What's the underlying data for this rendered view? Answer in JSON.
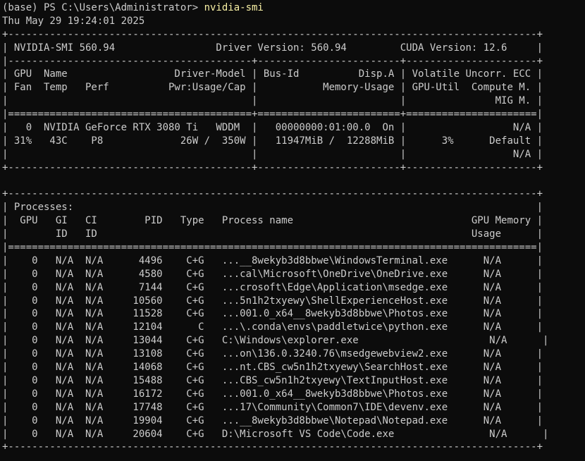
{
  "prompt": {
    "text": "(base) PS C:\\Users\\Administrator> ",
    "command": "nvidia-smi"
  },
  "timestamp": "Thu May 29 19:24:01 2025",
  "summary": {
    "border_top": "+-----------------------------------------------------------------------------------------+",
    "header": "| NVIDIA-SMI 560.94                 Driver Version: 560.94         CUDA Version: 12.6     |",
    "sep1": "|-----------------------------------------+------------------------+----------------------+",
    "col_header_1": "| GPU  Name                  Driver-Model | Bus-Id          Disp.A | Volatile Uncorr. ECC |",
    "col_header_2": "| Fan  Temp   Perf          Pwr:Usage/Cap |           Memory-Usage | GPU-Util  Compute M. |",
    "col_header_3": "|                                         |                        |               MIG M. |",
    "sep2": "|=========================================+========================+======================|",
    "gpu_row_1": "|   0  NVIDIA GeForce RTX 3080 Ti   WDDM  |   00000000:01:00.0  On |                  N/A |",
    "gpu_row_2": "| 31%   43C    P8             26W /  350W |   11947MiB /  12288MiB |      3%      Default |",
    "gpu_row_3": "|                                         |                        |                  N/A |",
    "border_bottom": "+-----------------------------------------+------------------------+----------------------+"
  },
  "blank": " ",
  "processes": {
    "border_top": "+-----------------------------------------------------------------------------------------+",
    "title": "| Processes:                                                                              |",
    "header_1": "|  GPU   GI   CI        PID   Type   Process name                              GPU Memory |",
    "header_2": "|        ID   ID                                                               Usage      |",
    "sep": "|=========================================================================================|",
    "rows": [
      "|    0   N/A  N/A      4496    C+G   ...__8wekyb3d8bbwe\\WindowsTerminal.exe      N/A      |",
      "|    0   N/A  N/A      4580    C+G   ...cal\\Microsoft\\OneDrive\\OneDrive.exe      N/A      |",
      "|    0   N/A  N/A      7144    C+G   ...crosoft\\Edge\\Application\\msedge.exe      N/A      |",
      "|    0   N/A  N/A     10560    C+G   ...5n1h2txyewy\\ShellExperienceHost.exe      N/A      |",
      "|    0   N/A  N/A     11528    C+G   ...001.0_x64__8wekyb3d8bbwe\\Photos.exe      N/A      |",
      "|    0   N/A  N/A     12104      C   ...\\.conda\\envs\\paddletwice\\python.exe      N/A      |",
      "|    0   N/A  N/A     13044    C+G   C:\\Windows\\explorer.exe                      N/A      |",
      "|    0   N/A  N/A     13108    C+G   ...on\\136.0.3240.76\\msedgewebview2.exe      N/A      |",
      "|    0   N/A  N/A     14068    C+G   ...nt.CBS_cw5n1h2txyewy\\SearchHost.exe      N/A      |",
      "|    0   N/A  N/A     15488    C+G   ...CBS_cw5n1h2txyewy\\TextInputHost.exe      N/A      |",
      "|    0   N/A  N/A     16172    C+G   ...001.0_x64__8wekyb3d8bbwe\\Photos.exe      N/A      |",
      "|    0   N/A  N/A     17748    C+G   ...17\\Community\\Common7\\IDE\\devenv.exe      N/A      |",
      "|    0   N/A  N/A     19904    C+G   ...__8wekyb3d8bbwe\\Notepad\\Notepad.exe      N/A      |",
      "|    0   N/A  N/A     20604    C+G   D:\\Microsoft VS Code\\Code.exe                N/A      |"
    ],
    "border_bottom": "+-----------------------------------------------------------------------------------------+"
  },
  "colors": {
    "background": "#0c0c0c",
    "text": "#cccccc",
    "command": "#f9f1a5"
  }
}
